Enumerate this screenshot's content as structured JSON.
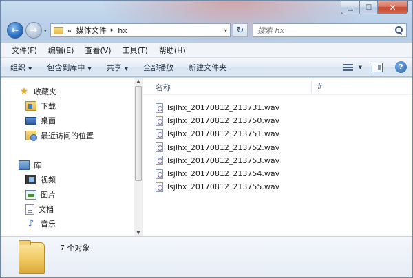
{
  "window": {
    "caption_buttons": {
      "minimize": "▁",
      "maximize": "□",
      "close": "✕"
    }
  },
  "address_bar": {
    "overflow": "«",
    "crumbs": [
      "媒体文件",
      "hx"
    ],
    "separator": "▸",
    "dropdown": "▾",
    "refresh": "↻",
    "search_placeholder": "搜索 hx"
  },
  "menu": [
    "文件(F)",
    "编辑(E)",
    "查看(V)",
    "工具(T)",
    "帮助(H)"
  ],
  "commands": [
    {
      "label": "组织",
      "caret": "▼"
    },
    {
      "label": "包含到库中",
      "caret": "▼"
    },
    {
      "label": "共享",
      "caret": "▼"
    },
    {
      "label": "全部播放",
      "caret": ""
    },
    {
      "label": "新建文件夹",
      "caret": ""
    }
  ],
  "view_caret": "▼",
  "help_glyph": "?",
  "nav": {
    "favorites": {
      "label": "收藏夹",
      "icon": "star-icon",
      "glyph": "★"
    },
    "favorite_items": [
      {
        "label": "下载",
        "icon": "downloads-icon"
      },
      {
        "label": "桌面",
        "icon": "desktop-icon"
      },
      {
        "label": "最近访问的位置",
        "icon": "recent-places-icon"
      }
    ],
    "library": {
      "label": "库",
      "icon": "library-icon"
    },
    "library_items": [
      {
        "label": "视频",
        "icon": "video-icon"
      },
      {
        "label": "图片",
        "icon": "picture-icon"
      },
      {
        "label": "文档",
        "icon": "document-icon"
      },
      {
        "label": "音乐",
        "icon": "music-icon",
        "glyph": "♪"
      }
    ],
    "scroll_up": "▲",
    "scroll_down": "▼"
  },
  "columns": {
    "name": "名称",
    "number": "#"
  },
  "files": [
    "lsjlhx_20170812_213731.wav",
    "lsjlhx_20170812_213750.wav",
    "lsjlhx_20170812_213751.wav",
    "lsjlhx_20170812_213752.wav",
    "lsjlhx_20170812_213753.wav",
    "lsjlhx_20170812_213754.wav",
    "lsjlhx_20170812_213755.wav"
  ],
  "status": {
    "count": "7 个对象"
  },
  "colors": {
    "chrome": "#bcd2ea",
    "command_bar": "#dde8f4",
    "close_button": "#c64a31",
    "folder": "#efc65a"
  }
}
